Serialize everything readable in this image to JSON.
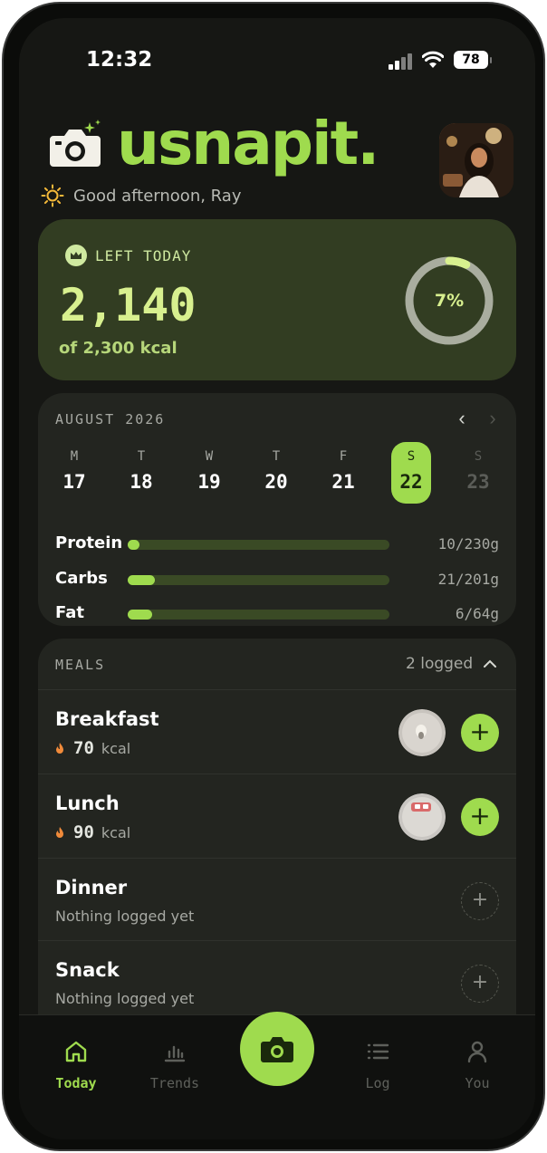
{
  "status_bar": {
    "time": "12:32",
    "battery": "78"
  },
  "header": {
    "logo_text": "usnapit.",
    "greeting": "Good afternoon, Ray"
  },
  "left_today": {
    "label": "LEFT TODAY",
    "remaining": "2,140",
    "goal_text": "of 2,300 kcal",
    "percent_label": "7%",
    "percent_value": 7
  },
  "calendar": {
    "month": "AUGUST 2026",
    "days": [
      {
        "letter": "M",
        "num": "17"
      },
      {
        "letter": "T",
        "num": "18"
      },
      {
        "letter": "W",
        "num": "19"
      },
      {
        "letter": "T",
        "num": "20"
      },
      {
        "letter": "F",
        "num": "21"
      },
      {
        "letter": "S",
        "num": "22"
      },
      {
        "letter": "S",
        "num": "23"
      }
    ],
    "selected_index": 5,
    "macros": [
      {
        "name": "Protein",
        "value": "10/230g",
        "fraction": 0.043
      },
      {
        "name": "Carbs",
        "value": "21/201g",
        "fraction": 0.104
      },
      {
        "name": "Fat",
        "value": "6/64g",
        "fraction": 0.094
      }
    ]
  },
  "meals": {
    "title": "MEALS",
    "count": "2 logged",
    "items": [
      {
        "name": "Breakfast",
        "kcal": "70",
        "unit": "kcal",
        "empty_text": ""
      },
      {
        "name": "Lunch",
        "kcal": "90",
        "unit": "kcal",
        "empty_text": ""
      },
      {
        "name": "Dinner",
        "kcal": "",
        "unit": "",
        "empty_text": "Nothing logged yet"
      },
      {
        "name": "Snack",
        "kcal": "",
        "unit": "",
        "empty_text": "Nothing logged yet"
      }
    ]
  },
  "tabbar": {
    "today": "Today",
    "trends": "Trends",
    "log": "Log",
    "you": "You"
  },
  "colors": {
    "accent": "#9fdb4e",
    "card_green": "#323d22",
    "background": "#161714"
  },
  "icons": {
    "logo": "camera-icon",
    "greeting": "sun-icon",
    "badge": "crown-icon",
    "prev": "chevron-left-icon",
    "next": "chevron-right-icon",
    "collapse": "chevron-up-icon",
    "kcal": "flame-icon",
    "add": "plus-icon",
    "tabs": [
      "home-icon",
      "bar-chart-icon",
      "camera-icon",
      "list-icon",
      "person-icon"
    ]
  }
}
